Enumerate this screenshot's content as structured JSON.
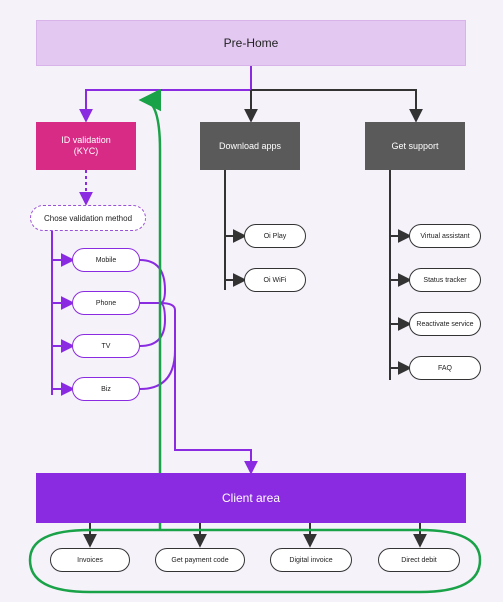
{
  "prehome": "Pre-Home",
  "id_validation": {
    "label": "ID validation\n(KYC)"
  },
  "download_apps": "Download apps",
  "get_support": "Get support",
  "chose_method": "Chose validation method",
  "channels": [
    "Mobile",
    "Phone",
    "TV",
    "Biz"
  ],
  "apps": [
    "Oi Play",
    "Oi WiFi"
  ],
  "support": [
    "Virtual assistant",
    "Status tracker",
    "Reactivate service",
    "FAQ"
  ],
  "client_area": "Client area",
  "client_items": [
    "Invoices",
    "Get payment code",
    "Digital invoice",
    "Direct debit"
  ]
}
